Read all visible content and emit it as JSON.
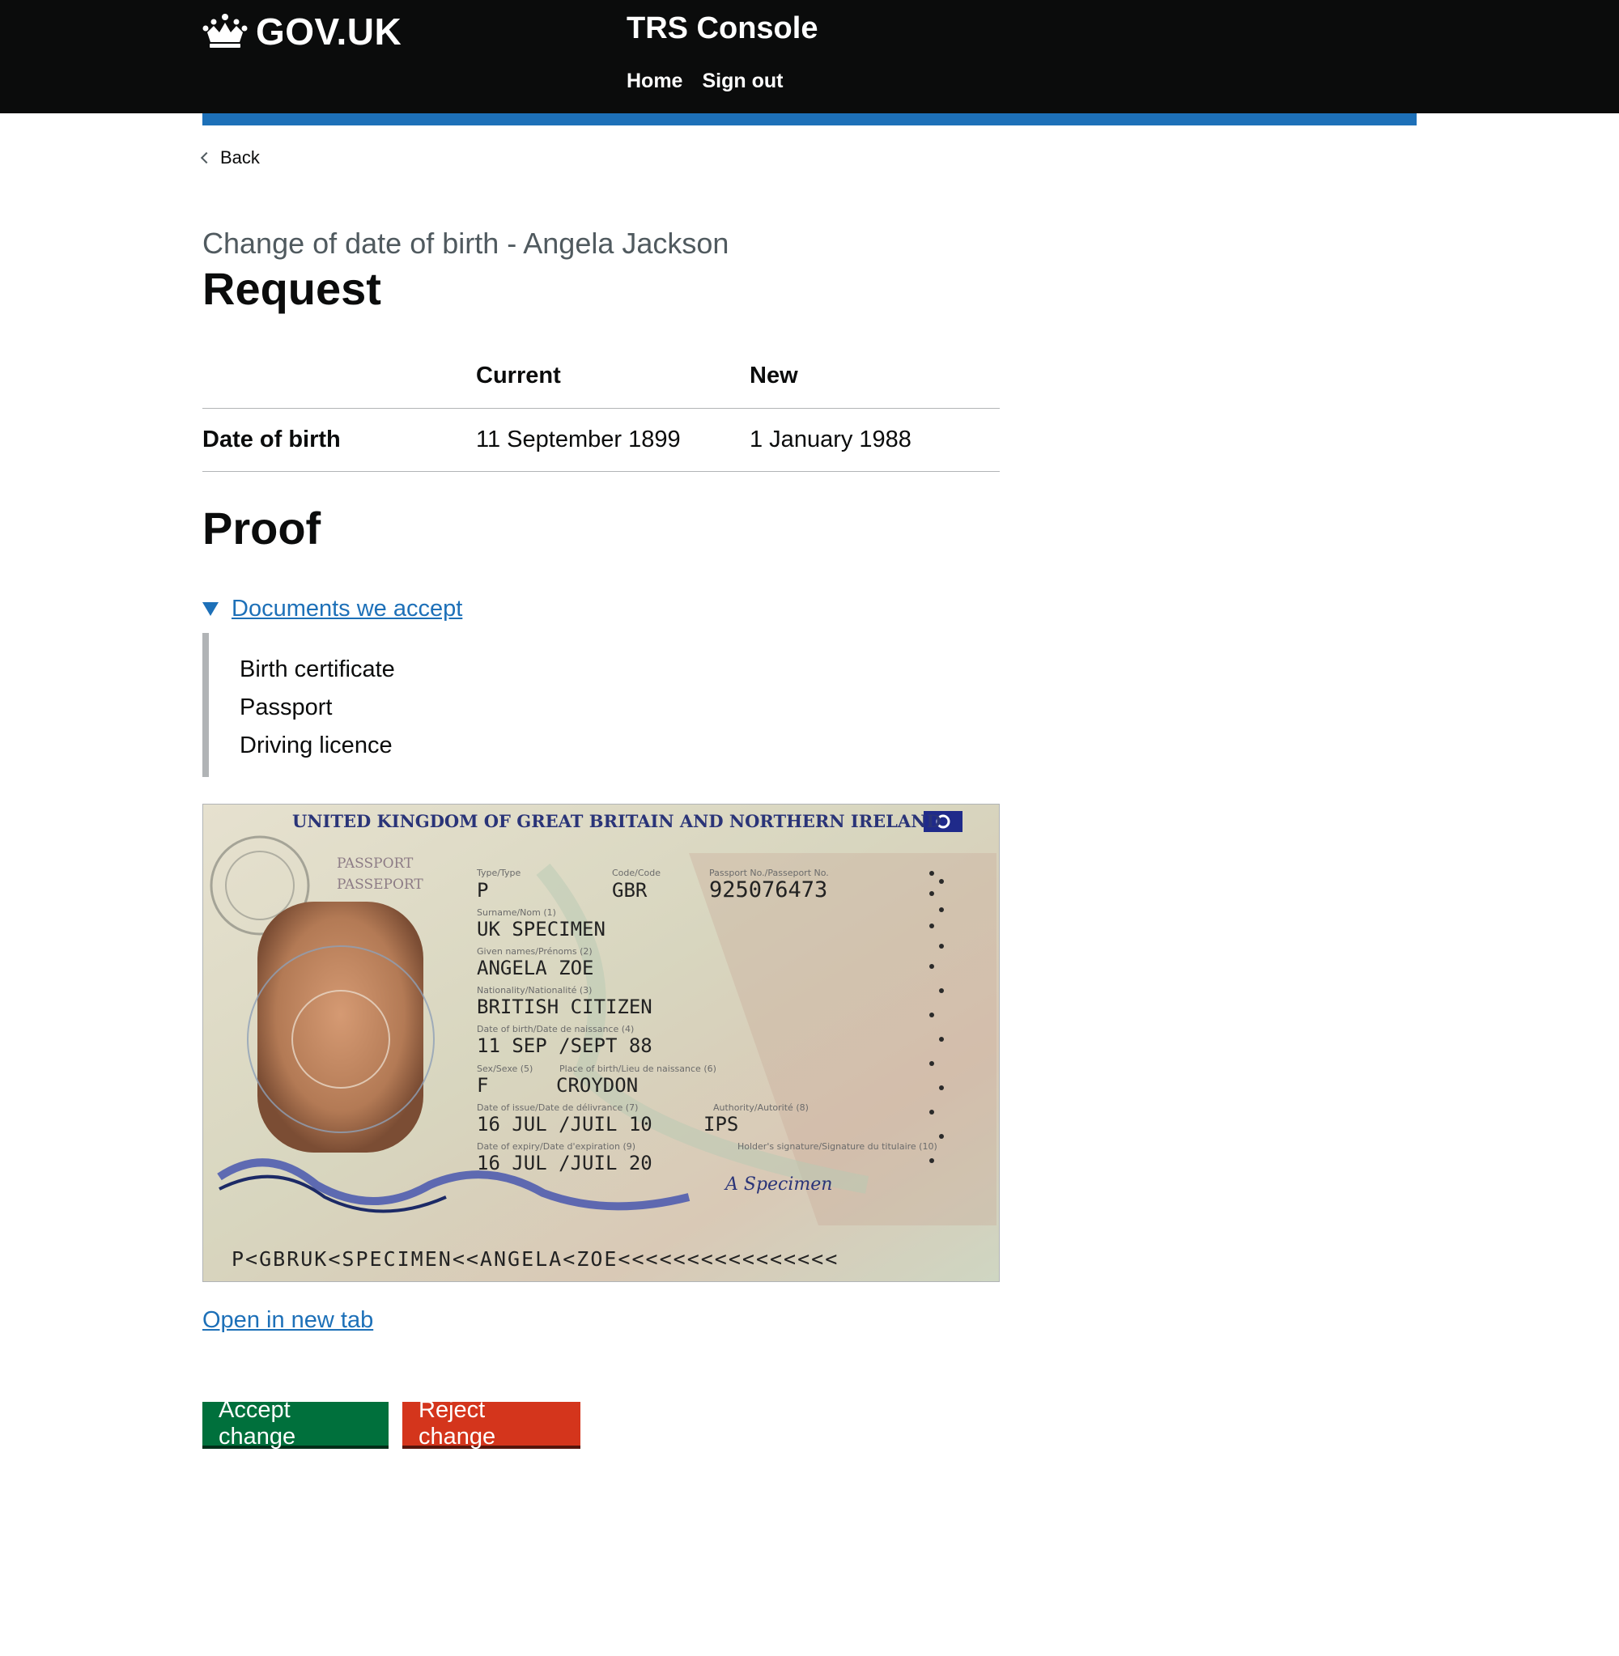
{
  "header": {
    "logo_text": "GOV.UK",
    "service_name": "TRS Console",
    "nav": [
      "Home",
      "Sign out"
    ]
  },
  "back_label": "Back",
  "caption": "Change of date of birth - Angela Jackson",
  "heading": "Request",
  "table": {
    "headers": [
      "",
      "Current",
      "New"
    ],
    "row": {
      "key": "Date of birth",
      "current": "11 September 1899",
      "new": "1 January 1988"
    }
  },
  "proof_heading": "Proof",
  "details": {
    "summary": "Documents we accept",
    "items": [
      "Birth certificate",
      "Passport",
      "Driving licence"
    ]
  },
  "passport": {
    "header": "UNITED KINGDOM OF GREAT BRITAIN AND NORTHERN IRELAND",
    "passport_label": "PASSPORT",
    "passport_label_fr": "PASSEPORT",
    "type_label": "Type/Type",
    "type": "P",
    "code_label": "Code/Code",
    "code": "GBR",
    "number_label": "Passport No./Passeport No.",
    "number": "925076473",
    "surname_label": "Surname/Nom (1)",
    "surname": "UK SPECIMEN",
    "given_label": "Given names/Prénoms (2)",
    "given": "ANGELA ZOE",
    "nationality_label": "Nationality/Nationalité (3)",
    "nationality": "BRITISH CITIZEN",
    "dob_label": "Date of birth/Date de naissance (4)",
    "dob": "11 SEP /SEPT 88",
    "sex_label": "Sex/Sexe (5)",
    "pob_label": "Place of birth/Lieu de naissance (6)",
    "sex": "F",
    "pob": "CROYDON",
    "issue_label": "Date of issue/Date de délivrance (7)",
    "authority_label": "Authority/Autorité (8)",
    "issue": "16 JUL /JUIL 10",
    "authority": "IPS",
    "expiry_label": "Date of expiry/Date d'expiration (9)",
    "signature_label": "Holder's signature/Signature du titulaire (10)",
    "expiry": "16 JUL /JUIL 20",
    "signature": "A Specimen",
    "mrz": "P<GBRUK<SPECIMEN<<ANGELA<ZOE<<<<<<<<<<<<<<<<"
  },
  "open_link": "Open in new tab",
  "buttons": {
    "accept": "Accept change",
    "reject": "Reject change"
  },
  "colors": {
    "header_bg": "#0b0c0c",
    "accent_blue": "#1d70b8",
    "link": "#1d70b8",
    "accept": "#00703c",
    "reject": "#d4351c"
  }
}
